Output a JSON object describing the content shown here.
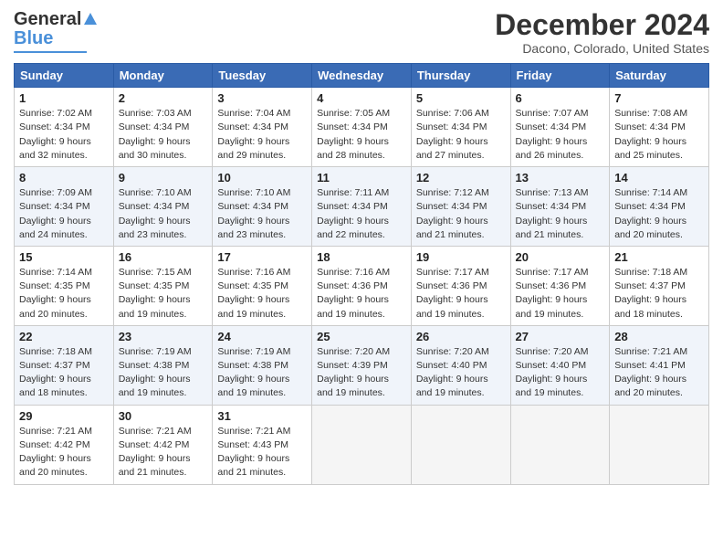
{
  "logo": {
    "part1": "General",
    "part2": "Blue"
  },
  "title": "December 2024",
  "location": "Dacono, Colorado, United States",
  "days_of_week": [
    "Sunday",
    "Monday",
    "Tuesday",
    "Wednesday",
    "Thursday",
    "Friday",
    "Saturday"
  ],
  "weeks": [
    [
      {
        "day": "1",
        "sunrise": "7:02 AM",
        "sunset": "4:34 PM",
        "daylight": "9 hours and 32 minutes."
      },
      {
        "day": "2",
        "sunrise": "7:03 AM",
        "sunset": "4:34 PM",
        "daylight": "9 hours and 30 minutes."
      },
      {
        "day": "3",
        "sunrise": "7:04 AM",
        "sunset": "4:34 PM",
        "daylight": "9 hours and 29 minutes."
      },
      {
        "day": "4",
        "sunrise": "7:05 AM",
        "sunset": "4:34 PM",
        "daylight": "9 hours and 28 minutes."
      },
      {
        "day": "5",
        "sunrise": "7:06 AM",
        "sunset": "4:34 PM",
        "daylight": "9 hours and 27 minutes."
      },
      {
        "day": "6",
        "sunrise": "7:07 AM",
        "sunset": "4:34 PM",
        "daylight": "9 hours and 26 minutes."
      },
      {
        "day": "7",
        "sunrise": "7:08 AM",
        "sunset": "4:34 PM",
        "daylight": "9 hours and 25 minutes."
      }
    ],
    [
      {
        "day": "8",
        "sunrise": "7:09 AM",
        "sunset": "4:34 PM",
        "daylight": "9 hours and 24 minutes."
      },
      {
        "day": "9",
        "sunrise": "7:10 AM",
        "sunset": "4:34 PM",
        "daylight": "9 hours and 23 minutes."
      },
      {
        "day": "10",
        "sunrise": "7:10 AM",
        "sunset": "4:34 PM",
        "daylight": "9 hours and 23 minutes."
      },
      {
        "day": "11",
        "sunrise": "7:11 AM",
        "sunset": "4:34 PM",
        "daylight": "9 hours and 22 minutes."
      },
      {
        "day": "12",
        "sunrise": "7:12 AM",
        "sunset": "4:34 PM",
        "daylight": "9 hours and 21 minutes."
      },
      {
        "day": "13",
        "sunrise": "7:13 AM",
        "sunset": "4:34 PM",
        "daylight": "9 hours and 21 minutes."
      },
      {
        "day": "14",
        "sunrise": "7:14 AM",
        "sunset": "4:34 PM",
        "daylight": "9 hours and 20 minutes."
      }
    ],
    [
      {
        "day": "15",
        "sunrise": "7:14 AM",
        "sunset": "4:35 PM",
        "daylight": "9 hours and 20 minutes."
      },
      {
        "day": "16",
        "sunrise": "7:15 AM",
        "sunset": "4:35 PM",
        "daylight": "9 hours and 19 minutes."
      },
      {
        "day": "17",
        "sunrise": "7:16 AM",
        "sunset": "4:35 PM",
        "daylight": "9 hours and 19 minutes."
      },
      {
        "day": "18",
        "sunrise": "7:16 AM",
        "sunset": "4:36 PM",
        "daylight": "9 hours and 19 minutes."
      },
      {
        "day": "19",
        "sunrise": "7:17 AM",
        "sunset": "4:36 PM",
        "daylight": "9 hours and 19 minutes."
      },
      {
        "day": "20",
        "sunrise": "7:17 AM",
        "sunset": "4:36 PM",
        "daylight": "9 hours and 19 minutes."
      },
      {
        "day": "21",
        "sunrise": "7:18 AM",
        "sunset": "4:37 PM",
        "daylight": "9 hours and 18 minutes."
      }
    ],
    [
      {
        "day": "22",
        "sunrise": "7:18 AM",
        "sunset": "4:37 PM",
        "daylight": "9 hours and 18 minutes."
      },
      {
        "day": "23",
        "sunrise": "7:19 AM",
        "sunset": "4:38 PM",
        "daylight": "9 hours and 19 minutes."
      },
      {
        "day": "24",
        "sunrise": "7:19 AM",
        "sunset": "4:38 PM",
        "daylight": "9 hours and 19 minutes."
      },
      {
        "day": "25",
        "sunrise": "7:20 AM",
        "sunset": "4:39 PM",
        "daylight": "9 hours and 19 minutes."
      },
      {
        "day": "26",
        "sunrise": "7:20 AM",
        "sunset": "4:40 PM",
        "daylight": "9 hours and 19 minutes."
      },
      {
        "day": "27",
        "sunrise": "7:20 AM",
        "sunset": "4:40 PM",
        "daylight": "9 hours and 19 minutes."
      },
      {
        "day": "28",
        "sunrise": "7:21 AM",
        "sunset": "4:41 PM",
        "daylight": "9 hours and 20 minutes."
      }
    ],
    [
      {
        "day": "29",
        "sunrise": "7:21 AM",
        "sunset": "4:42 PM",
        "daylight": "9 hours and 20 minutes."
      },
      {
        "day": "30",
        "sunrise": "7:21 AM",
        "sunset": "4:42 PM",
        "daylight": "9 hours and 21 minutes."
      },
      {
        "day": "31",
        "sunrise": "7:21 AM",
        "sunset": "4:43 PM",
        "daylight": "9 hours and 21 minutes."
      },
      null,
      null,
      null,
      null
    ]
  ]
}
